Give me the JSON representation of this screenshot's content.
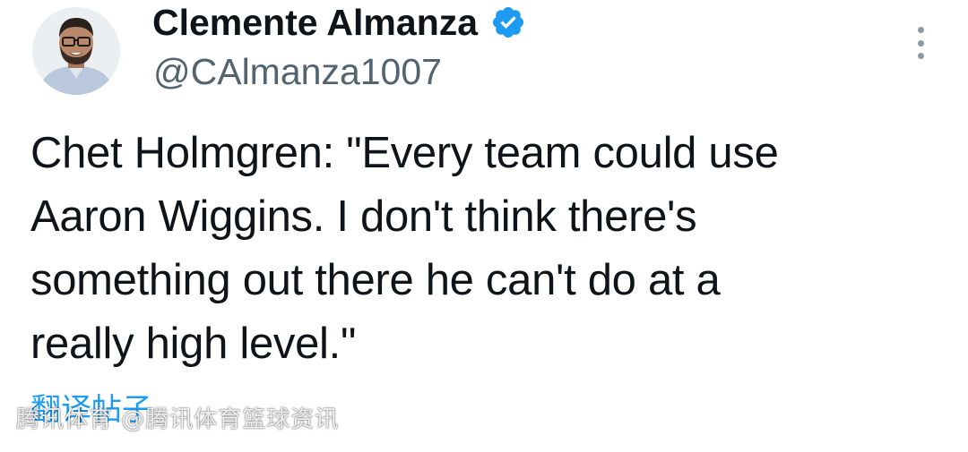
{
  "author": {
    "display_name": "Clemente Almanza",
    "handle": "@CAlmanza1007",
    "verified": true,
    "avatar_icon": "profile-photo"
  },
  "tweet": {
    "text": "Chet Holmgren: \"Every team could use\nAaron Wiggins. I don't think there's\nsomething out there he can't do at a\nreally high level.\""
  },
  "actions": {
    "translate_label": "翻译帖子",
    "more_icon": "more-vertical-icon"
  },
  "watermark": {
    "text": "腾讯体育 @腾讯体育篮球资讯"
  },
  "colors": {
    "verified_badge": "#1d9bf0",
    "link": "#1d9bf0",
    "secondary_text": "#536471",
    "primary_text": "#0f1419"
  }
}
